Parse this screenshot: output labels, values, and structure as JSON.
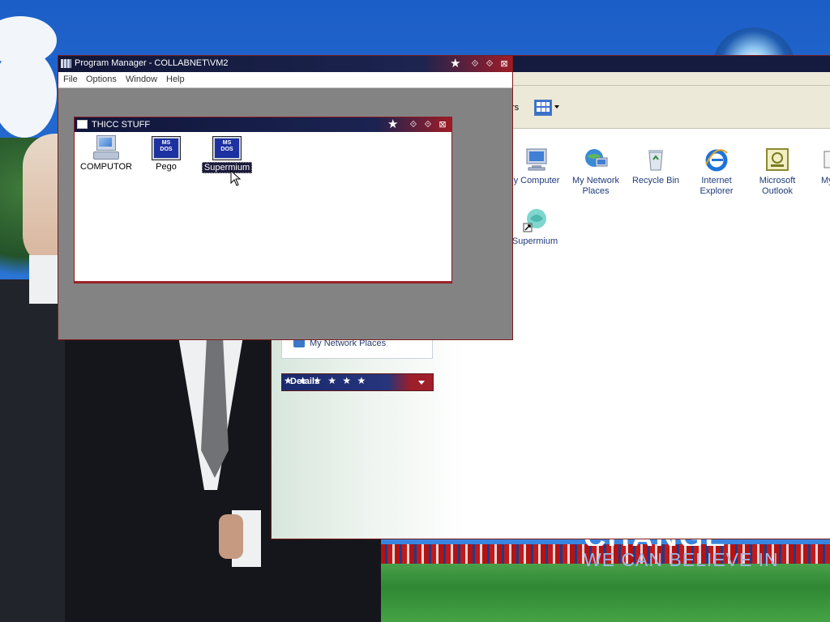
{
  "desktop": {
    "slogan_top": "CHANGE",
    "slogan": "WE CAN BELIEVE IN"
  },
  "explorer": {
    "toolbar_fragment": "rs",
    "sidebar": {
      "network_places": "My Network Places",
      "details": "Details",
      "details_stars": "★ ★ ★ ★ ★ ★"
    },
    "icons": [
      {
        "label": "y Computer",
        "icon": "computer-icon"
      },
      {
        "label": "My Network Places",
        "icon": "network-places-icon"
      },
      {
        "label": "Recycle Bin",
        "icon": "recycle-bin-icon"
      },
      {
        "label": "Internet Explorer",
        "icon": "internet-explorer-icon"
      },
      {
        "label": "Microsoft Outlook",
        "icon": "outlook-icon"
      },
      {
        "label": "My",
        "icon": "document-icon"
      },
      {
        "label": "Supermium",
        "icon": "supermium-icon"
      }
    ]
  },
  "program_manager": {
    "title": "Program Manager - COLLABNET\\VM2",
    "menu": [
      "File",
      "Options",
      "Window",
      "Help"
    ],
    "group": {
      "title": "THICC STUFF",
      "items": [
        {
          "label": "COMPUTOR",
          "icon": "computer-icon"
        },
        {
          "label": "Pego",
          "icon": "msdos-icon",
          "badge_top": "MS",
          "badge_bottom": "DOS"
        },
        {
          "label": "Supermium",
          "icon": "msdos-icon",
          "badge_top": "MS",
          "badge_bottom": "DOS",
          "selected": true
        }
      ]
    }
  },
  "colors": {
    "titlebar_navy": "#121737",
    "titlebar_red": "#9e1c26",
    "workspace_gray": "#838383",
    "selection": "#1b1b3a"
  }
}
